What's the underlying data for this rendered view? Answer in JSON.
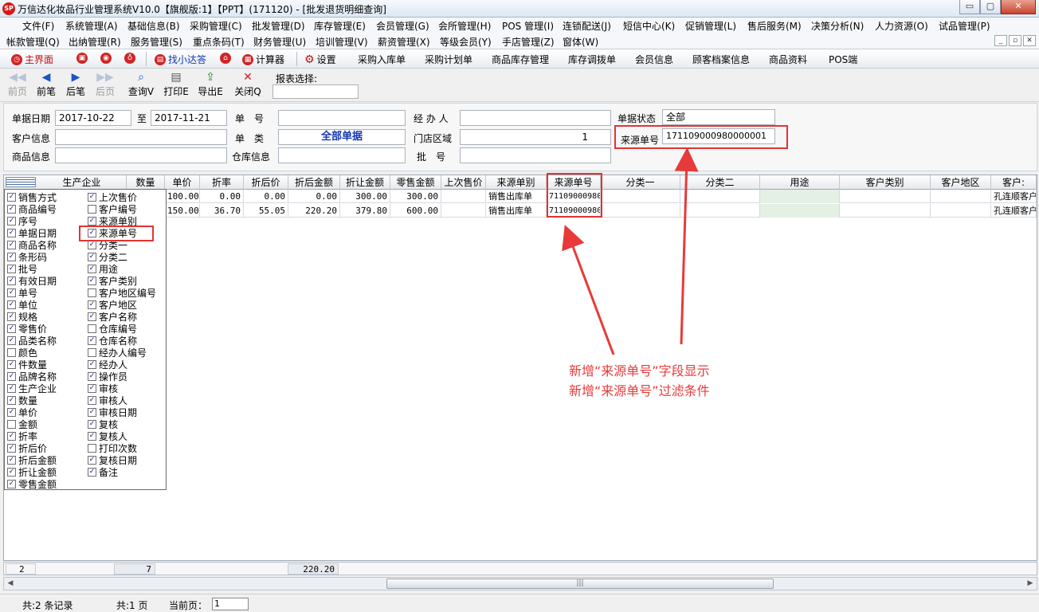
{
  "window": {
    "logo_text": "SP",
    "title": "万信达化妆品行业管理系统V10.0【旗舰版:1】【PPT】(171120) - [批发退货明细查询]",
    "buttons": [
      "▭",
      "▢",
      "✕"
    ]
  },
  "menu_row1": [
    "文件(F)",
    "系统管理(A)",
    "基础信息(B)",
    "采购管理(C)",
    "批发管理(D)",
    "库存管理(E)",
    "会员管理(G)",
    "会所管理(H)",
    "POS 管理(I)",
    "连锁配送(J)",
    "短信中心(K)",
    "促销管理(L)",
    "售后服务(M)",
    "决策分析(N)",
    "人力资源(O)",
    "试品管理(P)"
  ],
  "menu_row2": [
    "帐款管理(Q)",
    "出纳管理(R)",
    "服务管理(S)",
    "重点条码(T)",
    "财务管理(U)",
    "培训管理(V)",
    "薪资管理(X)",
    "等级会员(Y)",
    "手店管理(Z)",
    "窗体(W)"
  ],
  "quickbar": {
    "main": "主界面",
    "find": "找小达答",
    "calc": "计算器",
    "settings": "设置",
    "links": [
      "采购入库单",
      "采购计划单",
      "商品库存管理",
      "库存调拨单",
      "会员信息",
      "顾客档案信息",
      "商品资料",
      "POS端"
    ]
  },
  "report_toolbar": {
    "prev_page": "前页",
    "prev": "前笔",
    "next": "后笔",
    "next_page": "后页",
    "query": "查询V",
    "print": "打印E",
    "export": "导出E",
    "close": "关闭Q",
    "report_select_label": "报表选择:"
  },
  "filters": {
    "date_label": "单据日期",
    "date_from": "2017-10-22",
    "to_label": "至",
    "date_to": "2017-11-21",
    "doc_no_label": "单　号",
    "handler_label": "经 办 人",
    "status_label": "单据状态",
    "status_value": "全部",
    "customer_label": "客户信息",
    "doc_type_label": "单　类",
    "doc_type_value": "全部单据",
    "store_label": "门店区域",
    "store_value": "1",
    "source_no_label": "来源单号",
    "source_no_value": "171109000980000001",
    "product_label": "商品信息",
    "warehouse_label": "仓库信息",
    "batch_label": "批　号"
  },
  "grid": {
    "headers": [
      "生产企业",
      "数量",
      "单价",
      "折率",
      "折后价",
      "折后金额",
      "折让金额",
      "零售金额",
      "上次售价",
      "来源单别",
      "来源单号",
      "分类一",
      "分类二",
      "用途",
      "客户类别",
      "客户地区",
      "客户:"
    ],
    "rows": [
      [
        "",
        "",
        "100.00",
        "0.00",
        "0.00",
        "0.00",
        "300.00",
        "300.00",
        "",
        "销售出库单",
        "71109000980",
        "",
        "",
        "",
        "",
        "",
        "孔连顺客户"
      ],
      [
        "",
        "",
        "150.00",
        "36.70",
        "55.05",
        "220.20",
        "379.80",
        "600.00",
        "",
        "销售出库单",
        "71109000980",
        "",
        "",
        "",
        "",
        "",
        "孔连顺客户"
      ]
    ]
  },
  "column_chooser": {
    "left": [
      {
        "label": "销售方式",
        "checked": true
      },
      {
        "label": "商品编号",
        "checked": true
      },
      {
        "label": "序号",
        "checked": true
      },
      {
        "label": "单据日期",
        "checked": true
      },
      {
        "label": "商品名称",
        "checked": true
      },
      {
        "label": "条形码",
        "checked": true
      },
      {
        "label": "批号",
        "checked": true
      },
      {
        "label": "有效日期",
        "checked": true
      },
      {
        "label": "单号",
        "checked": true
      },
      {
        "label": "单位",
        "checked": true
      },
      {
        "label": "规格",
        "checked": true
      },
      {
        "label": "零售价",
        "checked": true
      },
      {
        "label": "品类名称",
        "checked": true
      },
      {
        "label": "颜色",
        "checked": false
      },
      {
        "label": "件数量",
        "checked": true
      },
      {
        "label": "品牌名称",
        "checked": true
      },
      {
        "label": "生产企业",
        "checked": true
      },
      {
        "label": "数量",
        "checked": true
      },
      {
        "label": "单价",
        "checked": true
      },
      {
        "label": "金额",
        "checked": false
      },
      {
        "label": "折率",
        "checked": true
      },
      {
        "label": "折后价",
        "checked": true
      },
      {
        "label": "折后金额",
        "checked": true
      },
      {
        "label": "折让金额",
        "checked": true
      },
      {
        "label": "零售金额",
        "checked": true
      }
    ],
    "right": [
      {
        "label": "上次售价",
        "checked": true
      },
      {
        "label": "客户编号",
        "checked": false
      },
      {
        "label": "来源单别",
        "checked": true
      },
      {
        "label": "来源单号",
        "checked": true
      },
      {
        "label": "分类一",
        "checked": true
      },
      {
        "label": "分类二",
        "checked": true
      },
      {
        "label": "用途",
        "checked": true
      },
      {
        "label": "客户类别",
        "checked": true
      },
      {
        "label": "客户地区编号",
        "checked": false
      },
      {
        "label": "客户地区",
        "checked": true
      },
      {
        "label": "客户名称",
        "checked": true
      },
      {
        "label": "仓库编号",
        "checked": false
      },
      {
        "label": "仓库名称",
        "checked": true
      },
      {
        "label": "经办人编号",
        "checked": false
      },
      {
        "label": "经办人",
        "checked": true
      },
      {
        "label": "操作员",
        "checked": true
      },
      {
        "label": "审核",
        "checked": true
      },
      {
        "label": "审核人",
        "checked": true
      },
      {
        "label": "审核日期",
        "checked": true
      },
      {
        "label": "复核",
        "checked": true
      },
      {
        "label": "复核人",
        "checked": true
      },
      {
        "label": "打印次数",
        "checked": false
      },
      {
        "label": "复核日期",
        "checked": true
      },
      {
        "label": "备注",
        "checked": true
      }
    ]
  },
  "annotation": {
    "line1": "新增“来源单号”字段显示",
    "line2": "新增“来源单号”过滤条件",
    "color": "#e83a3a"
  },
  "summary": {
    "count": "2",
    "qty": "7",
    "amount": "220.20"
  },
  "status": {
    "records": "共:2 条记录",
    "pages": "共:1 页",
    "current_label": "当前页：",
    "current_page": "1"
  }
}
